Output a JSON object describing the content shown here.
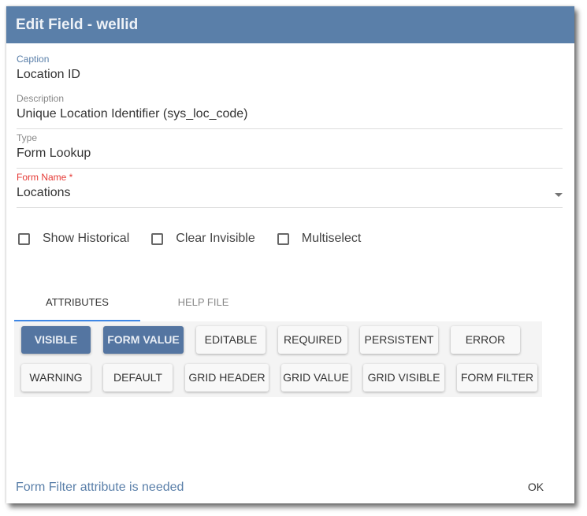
{
  "dialog": {
    "title": "Edit Field - wellid",
    "fields": {
      "caption": {
        "label": "Caption",
        "value": "Location ID"
      },
      "description": {
        "label": "Description",
        "value": "Unique Location Identifier (sys_loc_code)"
      },
      "type": {
        "label": "Type",
        "value": "Form Lookup"
      },
      "form_name": {
        "label": "Form Name *",
        "value": "Locations"
      }
    },
    "checkboxes": [
      {
        "label": "Show Historical",
        "checked": false
      },
      {
        "label": "Clear Invisible",
        "checked": false
      },
      {
        "label": "Multiselect",
        "checked": false
      }
    ],
    "tabs": [
      {
        "label": "ATTRIBUTES",
        "active": true
      },
      {
        "label": "HELP FILE",
        "active": false
      }
    ],
    "attributes": [
      {
        "label": "VISIBLE",
        "selected": true
      },
      {
        "label": "FORM VALUE",
        "selected": true
      },
      {
        "label": "EDITABLE",
        "selected": false
      },
      {
        "label": "REQUIRED",
        "selected": false
      },
      {
        "label": "PERSISTENT",
        "selected": false
      },
      {
        "label": "ERROR",
        "selected": false
      },
      {
        "label": "WARNING",
        "selected": false
      },
      {
        "label": "DEFAULT",
        "selected": false
      },
      {
        "label": "GRID HEADER",
        "selected": false
      },
      {
        "label": "GRID VALUE",
        "selected": false
      },
      {
        "label": "GRID VISIBLE",
        "selected": false
      },
      {
        "label": "FORM FILTER",
        "selected": false
      }
    ],
    "footer": {
      "message": "Form Filter attribute is needed",
      "ok_label": "OK"
    },
    "colors": {
      "header": "#5a7fa9",
      "selected_attribute": "#5475a1",
      "tab_indicator": "#3f87e5",
      "required_label": "#e53935"
    }
  }
}
